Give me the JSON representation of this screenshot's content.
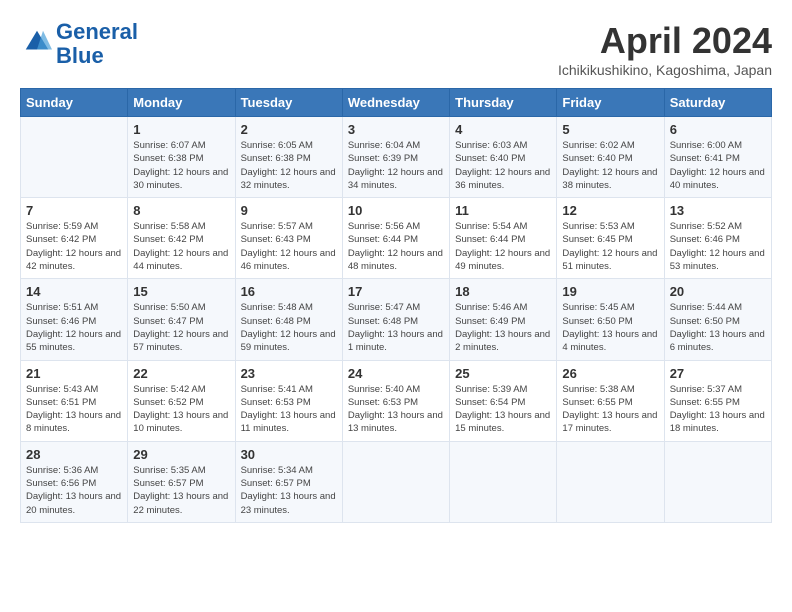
{
  "header": {
    "logo_line1": "General",
    "logo_line2": "Blue",
    "month": "April 2024",
    "location": "Ichikikushikino, Kagoshima, Japan"
  },
  "weekdays": [
    "Sunday",
    "Monday",
    "Tuesday",
    "Wednesday",
    "Thursday",
    "Friday",
    "Saturday"
  ],
  "weeks": [
    [
      {
        "day": "",
        "sunrise": "",
        "sunset": "",
        "daylight": ""
      },
      {
        "day": "1",
        "sunrise": "Sunrise: 6:07 AM",
        "sunset": "Sunset: 6:38 PM",
        "daylight": "Daylight: 12 hours and 30 minutes."
      },
      {
        "day": "2",
        "sunrise": "Sunrise: 6:05 AM",
        "sunset": "Sunset: 6:38 PM",
        "daylight": "Daylight: 12 hours and 32 minutes."
      },
      {
        "day": "3",
        "sunrise": "Sunrise: 6:04 AM",
        "sunset": "Sunset: 6:39 PM",
        "daylight": "Daylight: 12 hours and 34 minutes."
      },
      {
        "day": "4",
        "sunrise": "Sunrise: 6:03 AM",
        "sunset": "Sunset: 6:40 PM",
        "daylight": "Daylight: 12 hours and 36 minutes."
      },
      {
        "day": "5",
        "sunrise": "Sunrise: 6:02 AM",
        "sunset": "Sunset: 6:40 PM",
        "daylight": "Daylight: 12 hours and 38 minutes."
      },
      {
        "day": "6",
        "sunrise": "Sunrise: 6:00 AM",
        "sunset": "Sunset: 6:41 PM",
        "daylight": "Daylight: 12 hours and 40 minutes."
      }
    ],
    [
      {
        "day": "7",
        "sunrise": "Sunrise: 5:59 AM",
        "sunset": "Sunset: 6:42 PM",
        "daylight": "Daylight: 12 hours and 42 minutes."
      },
      {
        "day": "8",
        "sunrise": "Sunrise: 5:58 AM",
        "sunset": "Sunset: 6:42 PM",
        "daylight": "Daylight: 12 hours and 44 minutes."
      },
      {
        "day": "9",
        "sunrise": "Sunrise: 5:57 AM",
        "sunset": "Sunset: 6:43 PM",
        "daylight": "Daylight: 12 hours and 46 minutes."
      },
      {
        "day": "10",
        "sunrise": "Sunrise: 5:56 AM",
        "sunset": "Sunset: 6:44 PM",
        "daylight": "Daylight: 12 hours and 48 minutes."
      },
      {
        "day": "11",
        "sunrise": "Sunrise: 5:54 AM",
        "sunset": "Sunset: 6:44 PM",
        "daylight": "Daylight: 12 hours and 49 minutes."
      },
      {
        "day": "12",
        "sunrise": "Sunrise: 5:53 AM",
        "sunset": "Sunset: 6:45 PM",
        "daylight": "Daylight: 12 hours and 51 minutes."
      },
      {
        "day": "13",
        "sunrise": "Sunrise: 5:52 AM",
        "sunset": "Sunset: 6:46 PM",
        "daylight": "Daylight: 12 hours and 53 minutes."
      }
    ],
    [
      {
        "day": "14",
        "sunrise": "Sunrise: 5:51 AM",
        "sunset": "Sunset: 6:46 PM",
        "daylight": "Daylight: 12 hours and 55 minutes."
      },
      {
        "day": "15",
        "sunrise": "Sunrise: 5:50 AM",
        "sunset": "Sunset: 6:47 PM",
        "daylight": "Daylight: 12 hours and 57 minutes."
      },
      {
        "day": "16",
        "sunrise": "Sunrise: 5:48 AM",
        "sunset": "Sunset: 6:48 PM",
        "daylight": "Daylight: 12 hours and 59 minutes."
      },
      {
        "day": "17",
        "sunrise": "Sunrise: 5:47 AM",
        "sunset": "Sunset: 6:48 PM",
        "daylight": "Daylight: 13 hours and 1 minute."
      },
      {
        "day": "18",
        "sunrise": "Sunrise: 5:46 AM",
        "sunset": "Sunset: 6:49 PM",
        "daylight": "Daylight: 13 hours and 2 minutes."
      },
      {
        "day": "19",
        "sunrise": "Sunrise: 5:45 AM",
        "sunset": "Sunset: 6:50 PM",
        "daylight": "Daylight: 13 hours and 4 minutes."
      },
      {
        "day": "20",
        "sunrise": "Sunrise: 5:44 AM",
        "sunset": "Sunset: 6:50 PM",
        "daylight": "Daylight: 13 hours and 6 minutes."
      }
    ],
    [
      {
        "day": "21",
        "sunrise": "Sunrise: 5:43 AM",
        "sunset": "Sunset: 6:51 PM",
        "daylight": "Daylight: 13 hours and 8 minutes."
      },
      {
        "day": "22",
        "sunrise": "Sunrise: 5:42 AM",
        "sunset": "Sunset: 6:52 PM",
        "daylight": "Daylight: 13 hours and 10 minutes."
      },
      {
        "day": "23",
        "sunrise": "Sunrise: 5:41 AM",
        "sunset": "Sunset: 6:53 PM",
        "daylight": "Daylight: 13 hours and 11 minutes."
      },
      {
        "day": "24",
        "sunrise": "Sunrise: 5:40 AM",
        "sunset": "Sunset: 6:53 PM",
        "daylight": "Daylight: 13 hours and 13 minutes."
      },
      {
        "day": "25",
        "sunrise": "Sunrise: 5:39 AM",
        "sunset": "Sunset: 6:54 PM",
        "daylight": "Daylight: 13 hours and 15 minutes."
      },
      {
        "day": "26",
        "sunrise": "Sunrise: 5:38 AM",
        "sunset": "Sunset: 6:55 PM",
        "daylight": "Daylight: 13 hours and 17 minutes."
      },
      {
        "day": "27",
        "sunrise": "Sunrise: 5:37 AM",
        "sunset": "Sunset: 6:55 PM",
        "daylight": "Daylight: 13 hours and 18 minutes."
      }
    ],
    [
      {
        "day": "28",
        "sunrise": "Sunrise: 5:36 AM",
        "sunset": "Sunset: 6:56 PM",
        "daylight": "Daylight: 13 hours and 20 minutes."
      },
      {
        "day": "29",
        "sunrise": "Sunrise: 5:35 AM",
        "sunset": "Sunset: 6:57 PM",
        "daylight": "Daylight: 13 hours and 22 minutes."
      },
      {
        "day": "30",
        "sunrise": "Sunrise: 5:34 AM",
        "sunset": "Sunset: 6:57 PM",
        "daylight": "Daylight: 13 hours and 23 minutes."
      },
      {
        "day": "",
        "sunrise": "",
        "sunset": "",
        "daylight": ""
      },
      {
        "day": "",
        "sunrise": "",
        "sunset": "",
        "daylight": ""
      },
      {
        "day": "",
        "sunrise": "",
        "sunset": "",
        "daylight": ""
      },
      {
        "day": "",
        "sunrise": "",
        "sunset": "",
        "daylight": ""
      }
    ]
  ]
}
